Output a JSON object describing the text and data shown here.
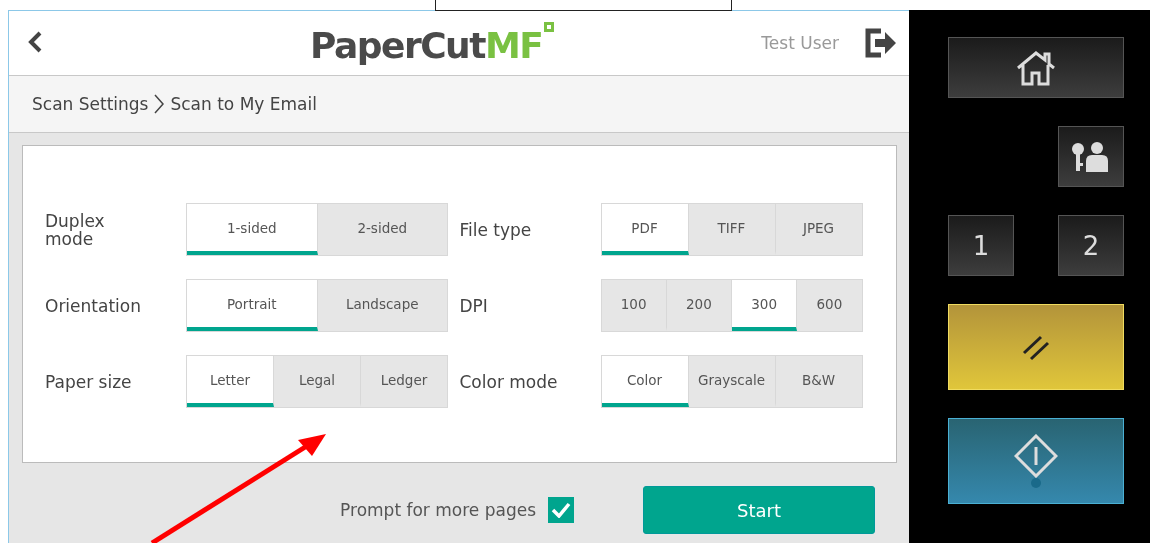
{
  "header": {
    "logo": {
      "main": "PaperCut",
      "suffix": "MF"
    },
    "user": "Test User"
  },
  "breadcrumb": [
    "Scan Settings",
    "Scan to My Email"
  ],
  "setting_columns": [
    {
      "settings": [
        {
          "label": "Duplex mode",
          "options": [
            {
              "label": "1-sided",
              "selected": true
            },
            {
              "label": "2-sided",
              "selected": false
            }
          ]
        },
        {
          "label": "Orientation",
          "options": [
            {
              "label": "Portrait",
              "selected": true
            },
            {
              "label": "Landscape",
              "selected": false
            }
          ]
        },
        {
          "label": "Paper size",
          "options": [
            {
              "label": "Letter",
              "selected": true
            },
            {
              "label": "Legal",
              "selected": false
            },
            {
              "label": "Ledger",
              "selected": false
            }
          ]
        }
      ]
    },
    {
      "settings": [
        {
          "label": "File type",
          "options": [
            {
              "label": "PDF",
              "selected": true
            },
            {
              "label": "TIFF",
              "selected": false
            },
            {
              "label": "JPEG",
              "selected": false
            }
          ]
        },
        {
          "label": "DPI",
          "options": [
            {
              "label": "100",
              "selected": false
            },
            {
              "label": "200",
              "selected": false
            },
            {
              "label": "300",
              "selected": true
            },
            {
              "label": "600",
              "selected": false
            }
          ]
        },
        {
          "label": "Color mode",
          "options": [
            {
              "label": "Color",
              "selected": true
            },
            {
              "label": "Grayscale",
              "selected": false
            },
            {
              "label": "B&W",
              "selected": false
            }
          ]
        }
      ]
    }
  ],
  "prompt": {
    "label": "Prompt for more pages",
    "checked": true
  },
  "start_button": "Start",
  "hardware_keys": [
    {
      "kind": "home"
    },
    {
      "kind": "login"
    },
    {
      "kind": "number",
      "label": "1"
    },
    {
      "kind": "number",
      "label": "2"
    },
    {
      "kind": "reset"
    },
    {
      "kind": "start"
    }
  ]
}
